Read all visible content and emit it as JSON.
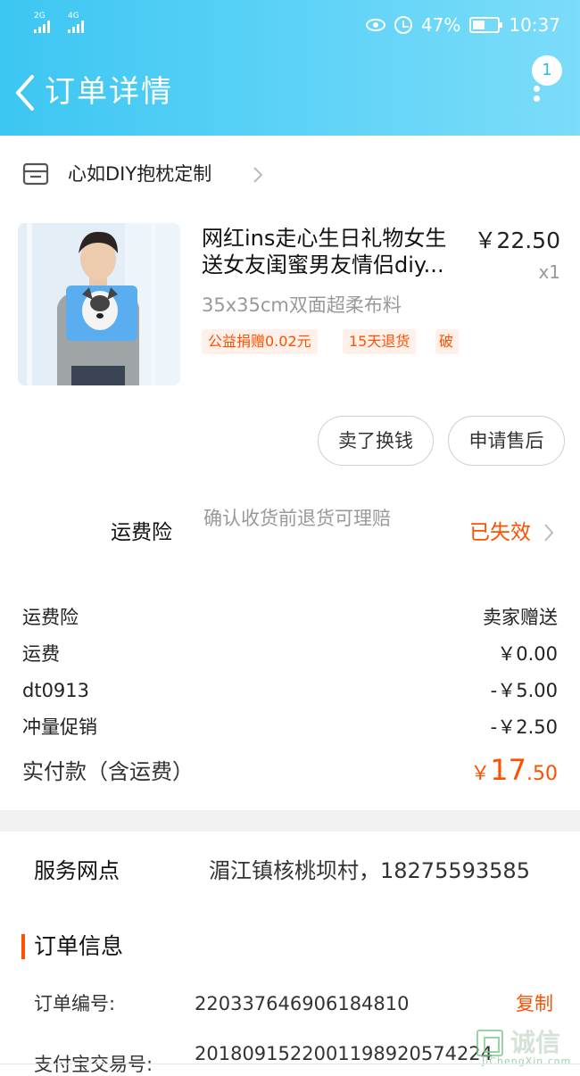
{
  "status_bar": {
    "signal1": "2G",
    "signal2": "4G",
    "battery_percent": "47%",
    "time": "10:37"
  },
  "header": {
    "title": "订单详情",
    "badge_count": "1",
    "bg_color": "#3cc6f2"
  },
  "shop": {
    "name": "心如DIY抱枕定制"
  },
  "product": {
    "title_line1": "网红ins走心生日礼物女生",
    "title_line2": "送女友闺蜜男友情侣diy...",
    "price": "￥22.50",
    "quantity": "x1",
    "spec": "35x35cm双面超柔布料",
    "tags": [
      "公益捐赠0.02元",
      "15天退货",
      "破"
    ]
  },
  "actions": {
    "sell_label": "卖了换钱",
    "after_sale_label": "申请售后"
  },
  "insurance": {
    "label": "运费险",
    "description": "确认收货前退货可理赔",
    "status": "已失效"
  },
  "fees": [
    {
      "label": "运费险",
      "value": "卖家赠送"
    },
    {
      "label": "运费",
      "value": "￥0.00"
    },
    {
      "label": "dt0913",
      "value": "-￥5.00"
    },
    {
      "label": "冲量促销",
      "value": "-￥2.50"
    }
  ],
  "total": {
    "label": "实付款（含运费）",
    "currency": "￥",
    "integer": "17",
    "decimal": ".50"
  },
  "service": {
    "label": "服务网点",
    "value": "湄江镇核桃坝村，18275593585"
  },
  "order_info": {
    "section_title": "订单信息",
    "order_no_label": "订单编号:",
    "order_no": "220337646906184810",
    "copy_label": "复制",
    "alipay_label": "支付宝交易号:",
    "alipay_no": "2018091522001198920574224"
  },
  "watermark": {
    "cn": "诚信",
    "en": "JiChengXin.com"
  },
  "colors": {
    "accent": "#ff5000",
    "header": "#3cc6f2"
  }
}
